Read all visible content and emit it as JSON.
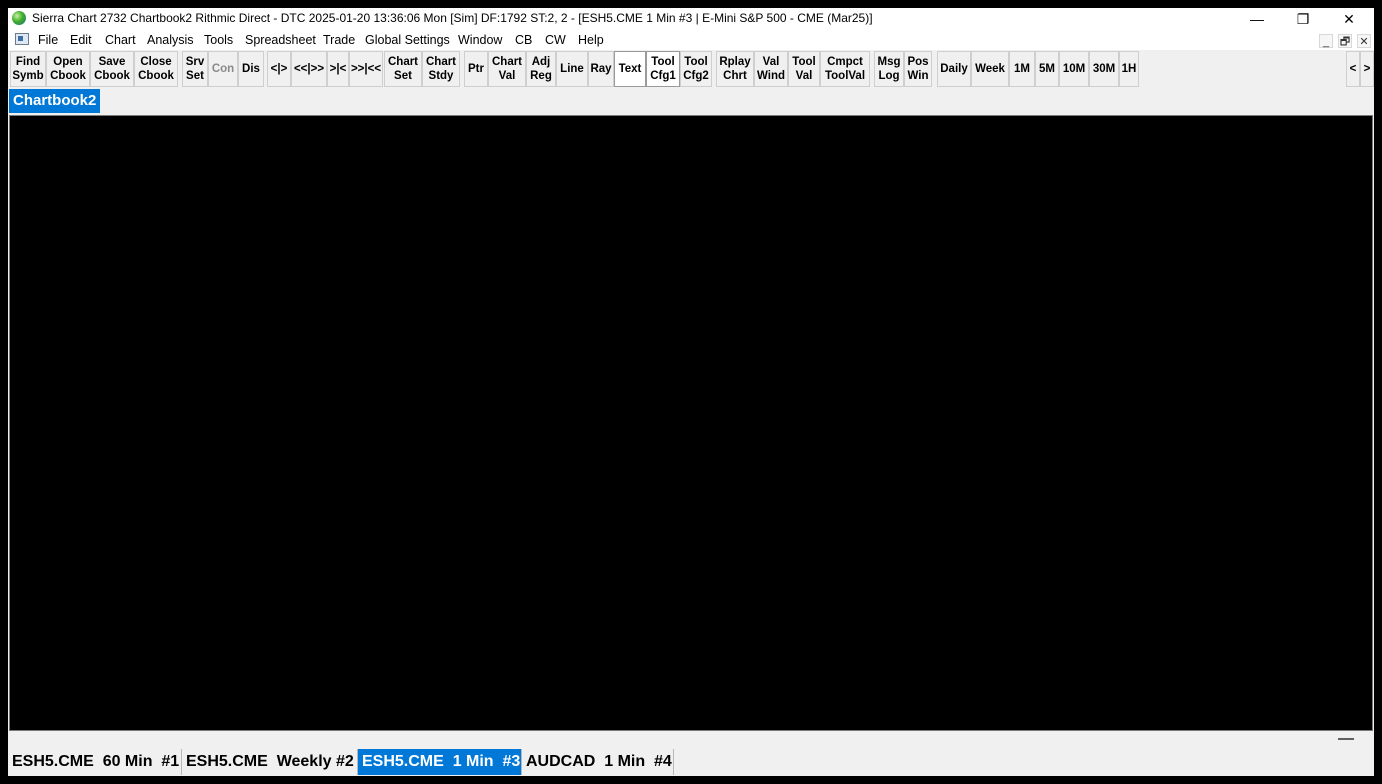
{
  "window": {
    "title": "Sierra Chart 2732 Chartbook2 Rithmic Direct - DTC 2025-01-20  13:36:06 Mon [Sim] DF:1792  ST:2, 2 - [ESH5.CME  1 Min  #3 | E-Mini S&P 500 - CME (Mar25)]",
    "minimize_glyph": "—",
    "restore_glyph": "❐",
    "close_glyph": "✕"
  },
  "menu": {
    "items": [
      "File",
      "Edit",
      "Chart",
      "Analysis",
      "Tools",
      "Spreadsheet",
      "Trade",
      "Global Settings",
      "Window",
      "CB",
      "CW",
      "Help"
    ],
    "mdi_minimize": "_",
    "mdi_restore": "🗗",
    "mdi_close": "✕"
  },
  "toolbar": {
    "buttons": [
      "Find\nSymb",
      "Open\nCbook",
      "Save\nCbook",
      "Close\nCbook",
      "Srv\nSet",
      "Con",
      "Dis",
      "<|>",
      "<<|>>",
      ">|<",
      ">>|<<",
      "Chart\nSet",
      "Chart\nStdy",
      "Ptr",
      "Chart\nVal",
      "Adj\nReg",
      "Line",
      "Ray",
      "Text",
      "Tool\nCfg1",
      "Tool\nCfg2",
      "Rplay\nChrt",
      "Val\nWind",
      "Tool\nVal",
      "Cmpct\nToolVal",
      "Msg\nLog",
      "Pos\nWin",
      "Daily",
      "Week",
      "1M",
      "5M",
      "10M",
      "30M",
      "1H"
    ],
    "scroll_left": "<",
    "scroll_right": ">"
  },
  "chartbook": {
    "tab_label": "Chartbook2"
  },
  "chart_tabs": [
    "ESH5.CME  60 Min  #1",
    "ESH5.CME  Weekly #2",
    "ESH5.CME  1 Min  #3",
    "AUDCAD  1 Min  #4"
  ],
  "colors": {
    "accent": "#0078d7",
    "chart_background": "#000000",
    "chrome": "#f0f0f0"
  }
}
